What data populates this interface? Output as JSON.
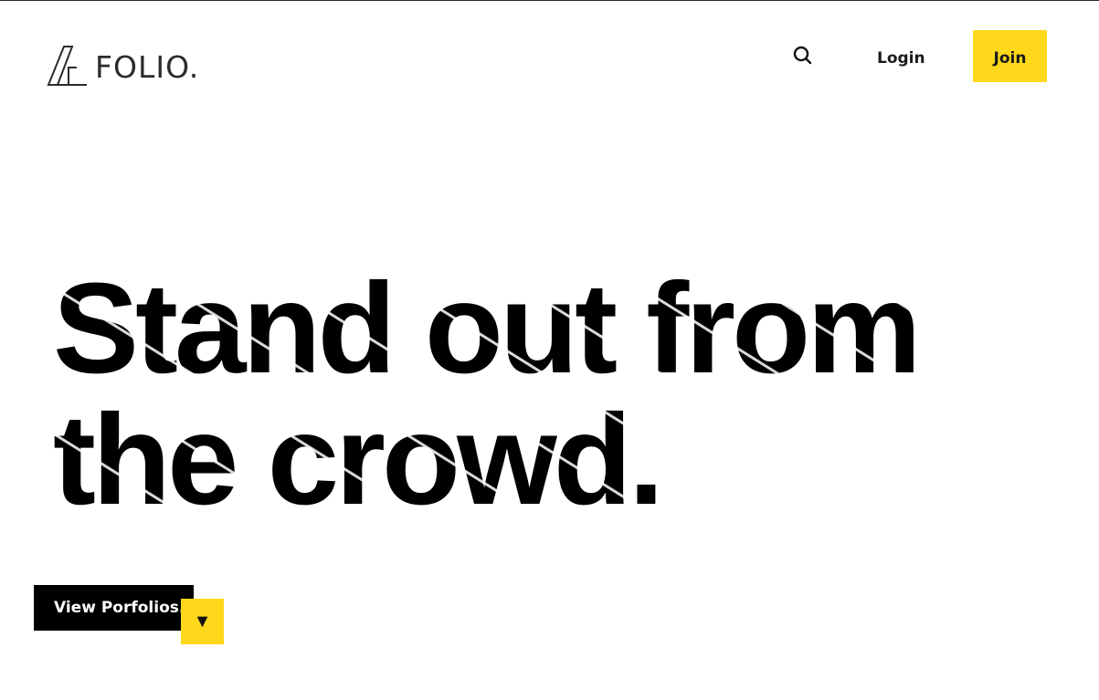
{
  "brand": {
    "name": "FOLIO."
  },
  "nav": {
    "search_icon": "search-icon",
    "login_label": "Login",
    "join_label": "Join"
  },
  "hero": {
    "line1": "Stand out from",
    "line2": "the crowd."
  },
  "cta": {
    "label": "View Porfolios.",
    "arrow": "▼",
    "arrow_icon": "caret-down-icon"
  },
  "colors": {
    "accent": "#ffd81b",
    "text": "#111111",
    "background": "#ffffff",
    "button_dark": "#000000"
  }
}
